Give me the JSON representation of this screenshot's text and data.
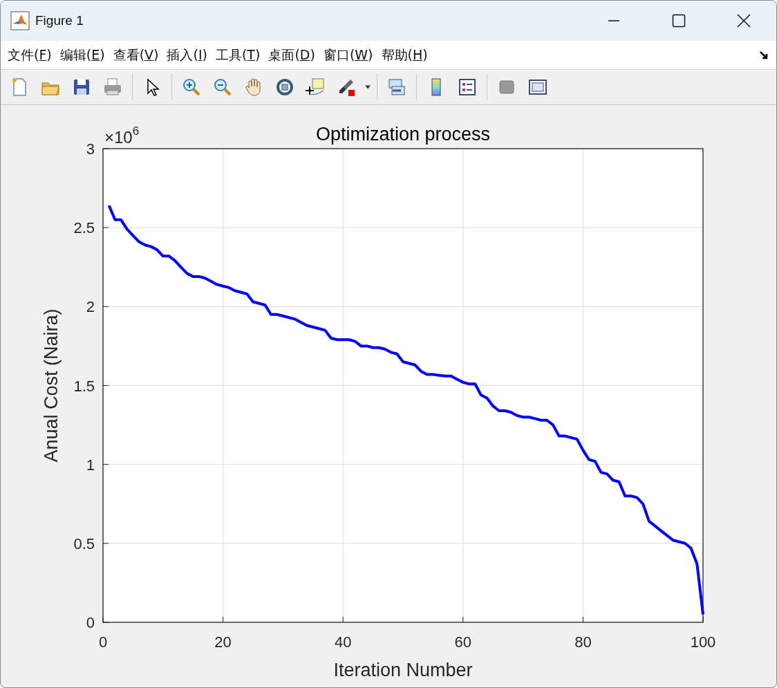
{
  "window": {
    "title": "Figure 1"
  },
  "menu": [
    "文件(F)",
    "编辑(E)",
    "查看(V)",
    "插入(I)",
    "工具(T)",
    "桌面(D)",
    "窗口(W)",
    "帮助(H)"
  ],
  "figure": {
    "exponent_label": "×10$^{6}$",
    "chart_data": {
      "type": "line",
      "grid": true,
      "title": "Optimization process",
      "xlabel": "Iteration Number",
      "ylabel": "Anual Cost (Naira)",
      "xlim": [
        0,
        100
      ],
      "ylim": [
        0,
        3
      ],
      "xticks": [
        0,
        20,
        40,
        60,
        80,
        100
      ],
      "yticks": [
        0,
        0.5,
        1,
        1.5,
        2,
        2.5,
        3
      ],
      "x": [
        1,
        2,
        3,
        4,
        5,
        6,
        7,
        8,
        9,
        10,
        11,
        12,
        13,
        14,
        15,
        16,
        17,
        18,
        19,
        20,
        21,
        22,
        23,
        24,
        25,
        26,
        27,
        28,
        29,
        30,
        31,
        32,
        33,
        34,
        35,
        36,
        37,
        38,
        39,
        40,
        41,
        42,
        43,
        44,
        45,
        46,
        47,
        48,
        49,
        50,
        51,
        52,
        53,
        54,
        55,
        56,
        57,
        58,
        59,
        60,
        61,
        62,
        63,
        64,
        65,
        66,
        67,
        68,
        69,
        70,
        71,
        72,
        73,
        74,
        75,
        76,
        77,
        78,
        79,
        80,
        81,
        82,
        83,
        84,
        85,
        86,
        87,
        88,
        89,
        90,
        91,
        92,
        93,
        94,
        95,
        96,
        97,
        98,
        99,
        100
      ],
      "series": [
        {
          "color": "#0000ff",
          "values": [
            2.64,
            2.55,
            2.55,
            2.49,
            2.45,
            2.41,
            2.39,
            2.38,
            2.36,
            2.32,
            2.32,
            2.29,
            2.25,
            2.21,
            2.19,
            2.19,
            2.18,
            2.16,
            2.14,
            2.13,
            2.12,
            2.1,
            2.09,
            2.08,
            2.03,
            2.02,
            2.01,
            1.95,
            1.95,
            1.94,
            1.93,
            1.92,
            1.9,
            1.88,
            1.87,
            1.86,
            1.85,
            1.8,
            1.79,
            1.79,
            1.79,
            1.78,
            1.75,
            1.75,
            1.74,
            1.74,
            1.73,
            1.71,
            1.7,
            1.65,
            1.64,
            1.63,
            1.59,
            1.57,
            1.57,
            1.565,
            1.56,
            1.56,
            1.54,
            1.52,
            1.51,
            1.51,
            1.44,
            1.42,
            1.37,
            1.34,
            1.34,
            1.33,
            1.31,
            1.3,
            1.3,
            1.29,
            1.28,
            1.28,
            1.25,
            1.18,
            1.18,
            1.17,
            1.16,
            1.09,
            1.03,
            1.02,
            0.95,
            0.94,
            0.9,
            0.89,
            0.8,
            0.8,
            0.79,
            0.75,
            0.64,
            0.61,
            0.58,
            0.55,
            0.52,
            0.51,
            0.5,
            0.47,
            0.37,
            0.05
          ]
        }
      ]
    }
  }
}
